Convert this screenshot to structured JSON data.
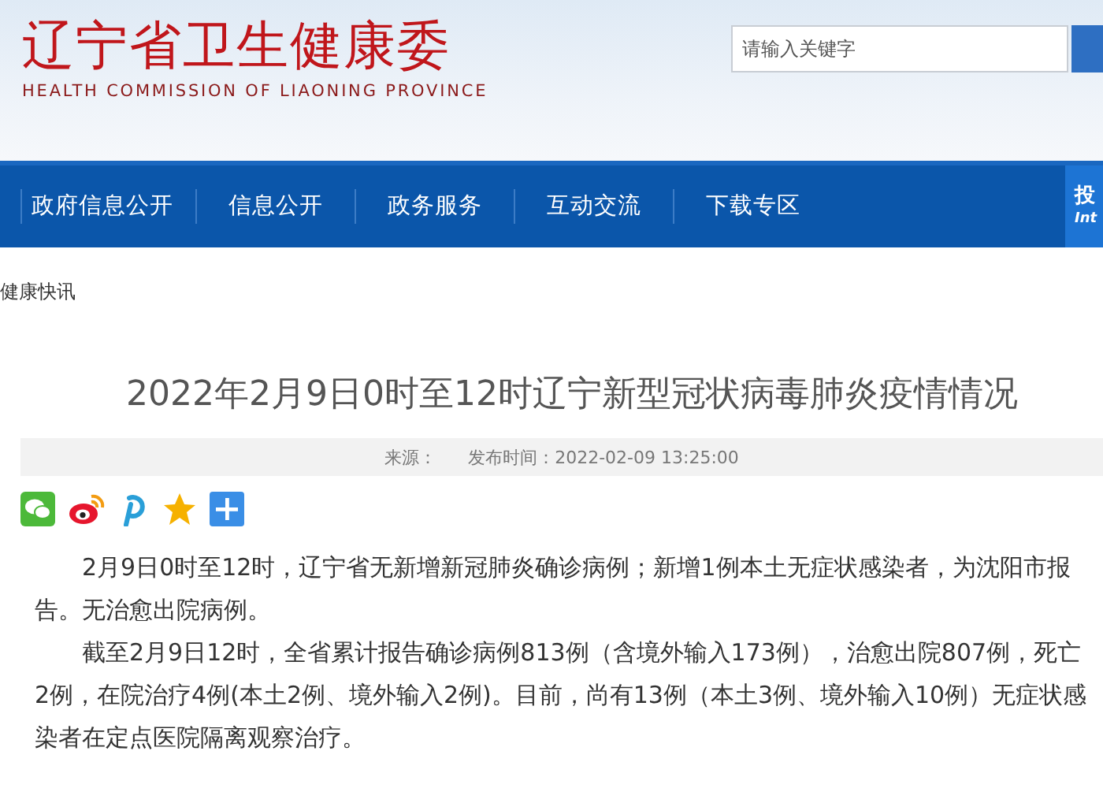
{
  "header": {
    "logo_title": "辽宁省卫生健康委",
    "logo_subtitle": "HEALTH COMMISSION OF LIAONING PROVINCE",
    "search": {
      "placeholder": "请输入关键字"
    }
  },
  "nav": {
    "items": [
      {
        "label": "政府信息公开"
      },
      {
        "label": "信息公开"
      },
      {
        "label": "政务服务"
      },
      {
        "label": "互动交流"
      },
      {
        "label": "下载专区"
      }
    ],
    "corner_tab": {
      "line_1": "投",
      "line_2": "Int"
    }
  },
  "breadcrumb": "健康快讯",
  "article": {
    "title": "2022年2月9日0时至12时辽宁新型冠状病毒肺炎疫情情况",
    "source_label": "来源：",
    "published": "发布时间：2022-02-09 13:25:00",
    "share_icons": [
      {
        "kind": "wechat"
      },
      {
        "kind": "weibo"
      },
      {
        "kind": "pinterest"
      },
      {
        "kind": "qzone"
      },
      {
        "kind": "more"
      }
    ],
    "paragraphs": [
      "2月9日0时至12时，辽宁省无新增新冠肺炎确诊病例；新增1例本土无症状感染者，为沈阳市报告。无治愈出院病例。",
      "截至2月9日12时，全省累计报告确诊病例813例（含境外输入173例），治愈出院807例，死亡2例，在院治疗4例(本土2例、境外输入2例)。目前，尚有13例（本土3例、境外输入10例）无症状感染者在定点医院隔离观察治疗。"
    ]
  }
}
